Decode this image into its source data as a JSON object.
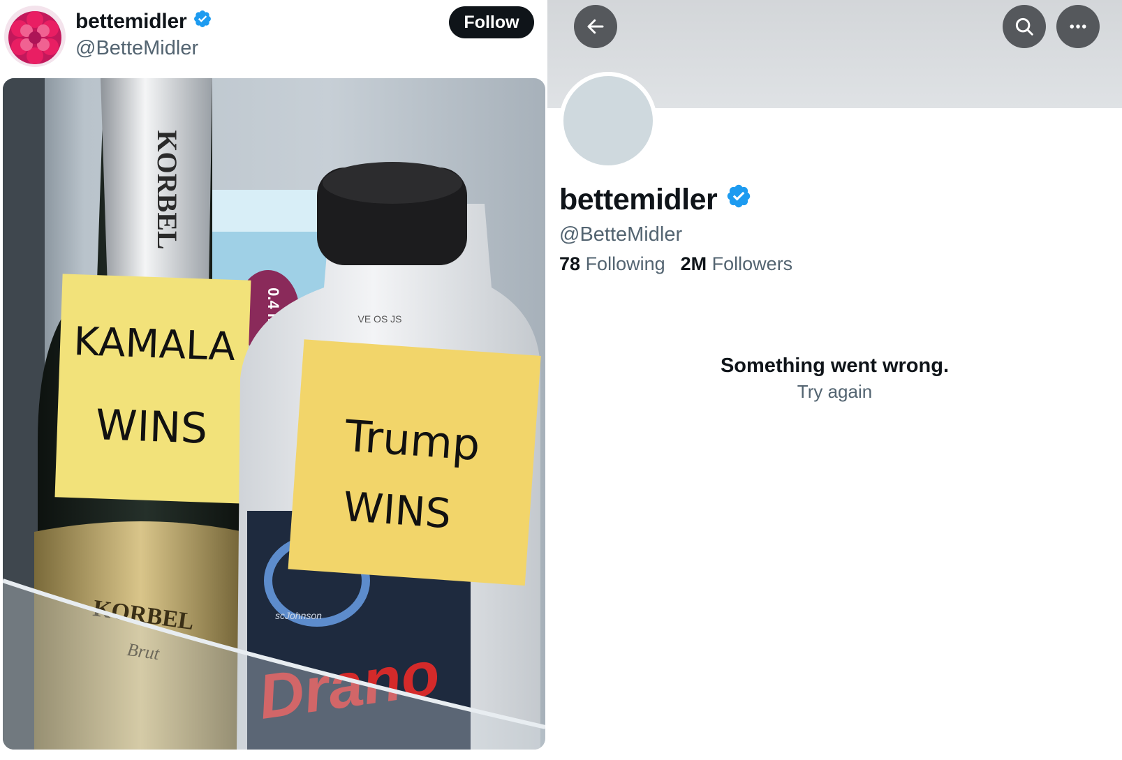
{
  "tweet": {
    "display_name": "bettemidler",
    "handle": "@BetteMidler",
    "follow_label": "Follow",
    "photo": {
      "champagne_brand": "KORBEL",
      "champagne_brand_bottom": "KORBEL",
      "champagne_sub": "Brut",
      "box_dose": "0.4 mL",
      "cap_code": "VE OS JS",
      "note_left_line1": "KAMALA",
      "note_left_line2": "WINS",
      "note_right_line1": "Trump",
      "note_right_line2": "WINS",
      "drain_brand": "Drano",
      "drain_maker": "scJohnson"
    }
  },
  "profile": {
    "display_name": "bettemidler",
    "handle": "@BetteMidler",
    "following_count": "78",
    "following_label": "Following",
    "followers_count": "2M",
    "followers_label": "Followers",
    "error_title": "Something went wrong.",
    "retry_label": "Try again"
  },
  "icons": {
    "back": "arrow-left-icon",
    "search": "search-icon",
    "more": "more-horizontal-icon",
    "verified": "verified-badge-icon"
  },
  "colors": {
    "verified_blue": "#1d9bf0",
    "follow_button": "#0f1419",
    "header_button": "#55585c",
    "secondary_text": "#536471",
    "banner": "#d8dbde",
    "avatar_placeholder": "#cfd9de",
    "sticky_note": "#f2e27a"
  }
}
